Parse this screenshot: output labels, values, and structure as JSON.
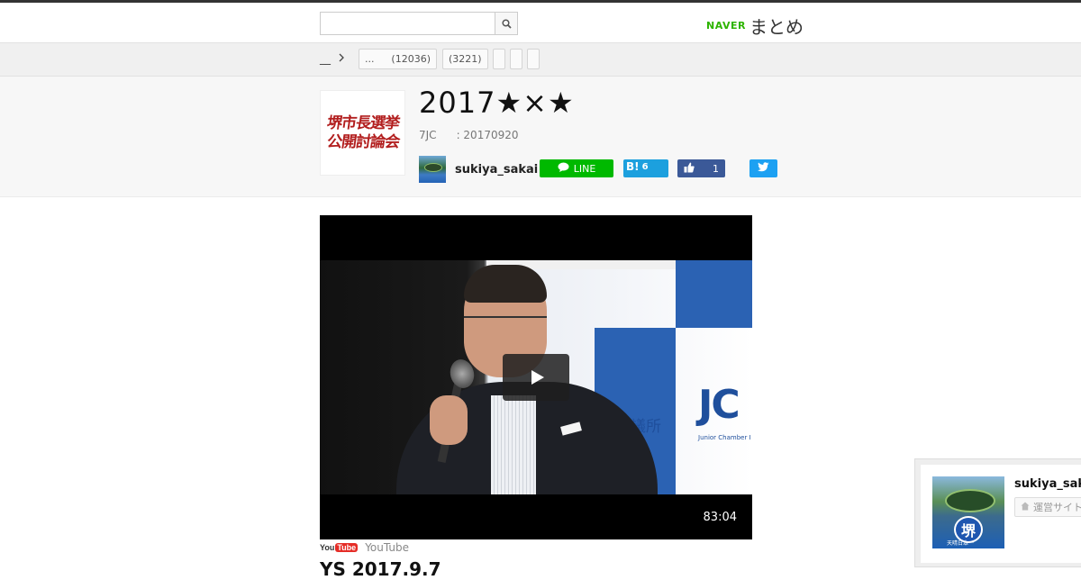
{
  "search": {
    "placeholder": "",
    "value": ""
  },
  "logo": {
    "naver": "NAVER",
    "matome": "まとめ"
  },
  "breadcrumb": {
    "home": "__",
    "tags": [
      "...",
      "(12036)",
      "(3221)",
      "",
      "",
      ""
    ]
  },
  "article": {
    "title": "2017★×★",
    "source": "7JC",
    "date": ": 20170920",
    "thumbnail_text": [
      "堺市長選挙",
      "公開討論会"
    ]
  },
  "author": {
    "name": "sukiya_sakai"
  },
  "share": {
    "line_label": "LINE",
    "hatena_label": "B!",
    "hatena_count": "6",
    "facebook_count": "1"
  },
  "video": {
    "duration": "83:04",
    "source_label": "YouTube",
    "yt_logo_you": "You",
    "yt_logo_tube": "Tube",
    "overlay_banner": "Junior Chamber International Sakai Takaishi",
    "overlay_big": "JC",
    "overlay_sub": "Junior Chamber I",
    "overlay_kanji": "議所"
  },
  "next_heading": "YS  2017.9.7",
  "float_card": {
    "name": "sukiya_sakai",
    "button_label": "運営サイト",
    "seal": "堺",
    "seal_sub": "天晴日本一"
  },
  "colors": {
    "line": "#00b900",
    "hatena": "#1ca0de",
    "facebook": "#3b5998",
    "twitter": "#1da1f2",
    "naver_green": "#2db400"
  }
}
